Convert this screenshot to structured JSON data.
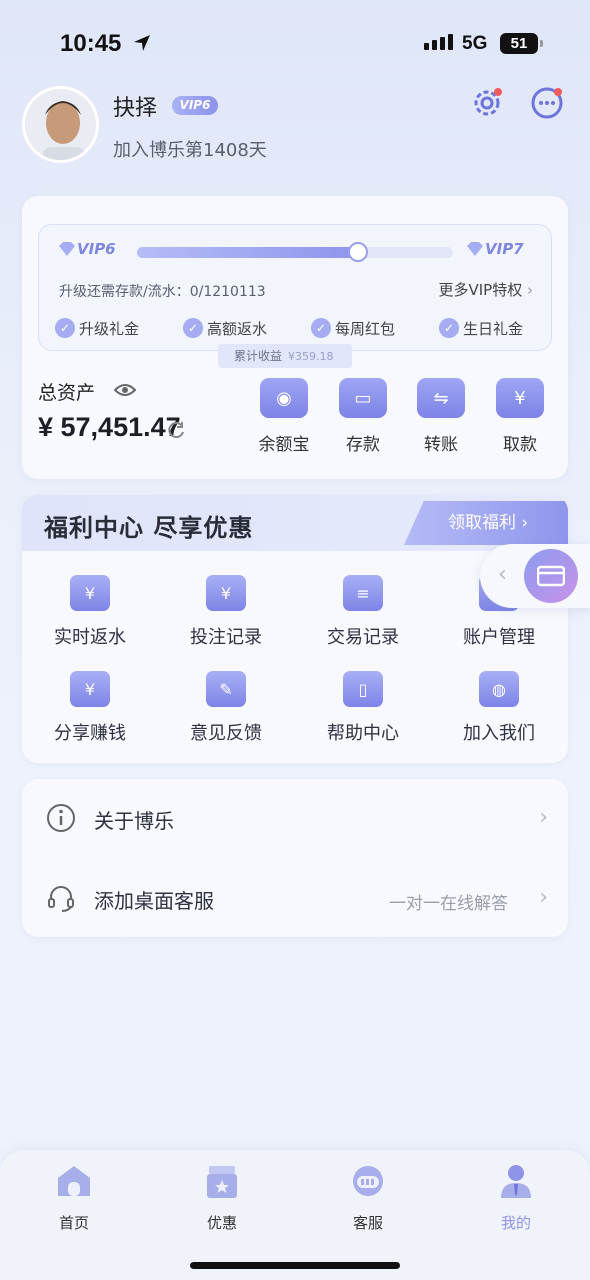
{
  "status_bar": {
    "time": "10:45",
    "network": "5G",
    "battery": "51"
  },
  "profile": {
    "username": "抉择",
    "vip_badge": "VIP6",
    "join_text": "加入博乐第1408天"
  },
  "vip": {
    "current": "VIP6",
    "next": "VIP7",
    "progress": 0.7,
    "upgrade_text": "升级还需存款/流水：0/1210113",
    "more_label": "更多VIP特权",
    "perks": [
      "升级礼金",
      "高额返水",
      "每周红包",
      "生日礼金"
    ]
  },
  "earnings": {
    "label": "累计收益",
    "value": "¥359.18"
  },
  "assets": {
    "label": "总资产",
    "value": "¥ 57,451.47"
  },
  "actions": [
    {
      "label": "余额宝",
      "icon": "coin-stack-icon"
    },
    {
      "label": "存款",
      "icon": "wallet-icon"
    },
    {
      "label": "转账",
      "icon": "transfer-icon"
    },
    {
      "label": "取款",
      "icon": "yen-ticket-icon"
    }
  ],
  "welfare": {
    "title": "福利中心  尽享优惠",
    "button": "领取福利",
    "items": [
      {
        "label": "实时返水",
        "icon": "money-bag-icon"
      },
      {
        "label": "投注记录",
        "icon": "bet-record-icon"
      },
      {
        "label": "交易记录",
        "icon": "clipboard-icon"
      },
      {
        "label": "账户管理",
        "icon": "account-icon"
      },
      {
        "label": "分享赚钱",
        "icon": "hand-coin-icon"
      },
      {
        "label": "意见反馈",
        "icon": "feedback-icon"
      },
      {
        "label": "帮助中心",
        "icon": "help-book-icon"
      },
      {
        "label": "加入我们",
        "icon": "users-icon"
      }
    ]
  },
  "list": [
    {
      "label": "关于博乐",
      "sub": "",
      "icon": "info-icon"
    },
    {
      "label": "添加桌面客服",
      "sub": "一对一在线解答",
      "icon": "headset-icon"
    }
  ],
  "tabs": [
    {
      "label": "首页",
      "icon": "home-icon",
      "active": false
    },
    {
      "label": "优惠",
      "icon": "gift-box-icon",
      "active": false
    },
    {
      "label": "客服",
      "icon": "support-icon",
      "active": false
    },
    {
      "label": "我的",
      "icon": "profile-icon",
      "active": true
    }
  ],
  "colors": {
    "accent": "#8e95e9",
    "badge_dot": "#f05a5a"
  }
}
